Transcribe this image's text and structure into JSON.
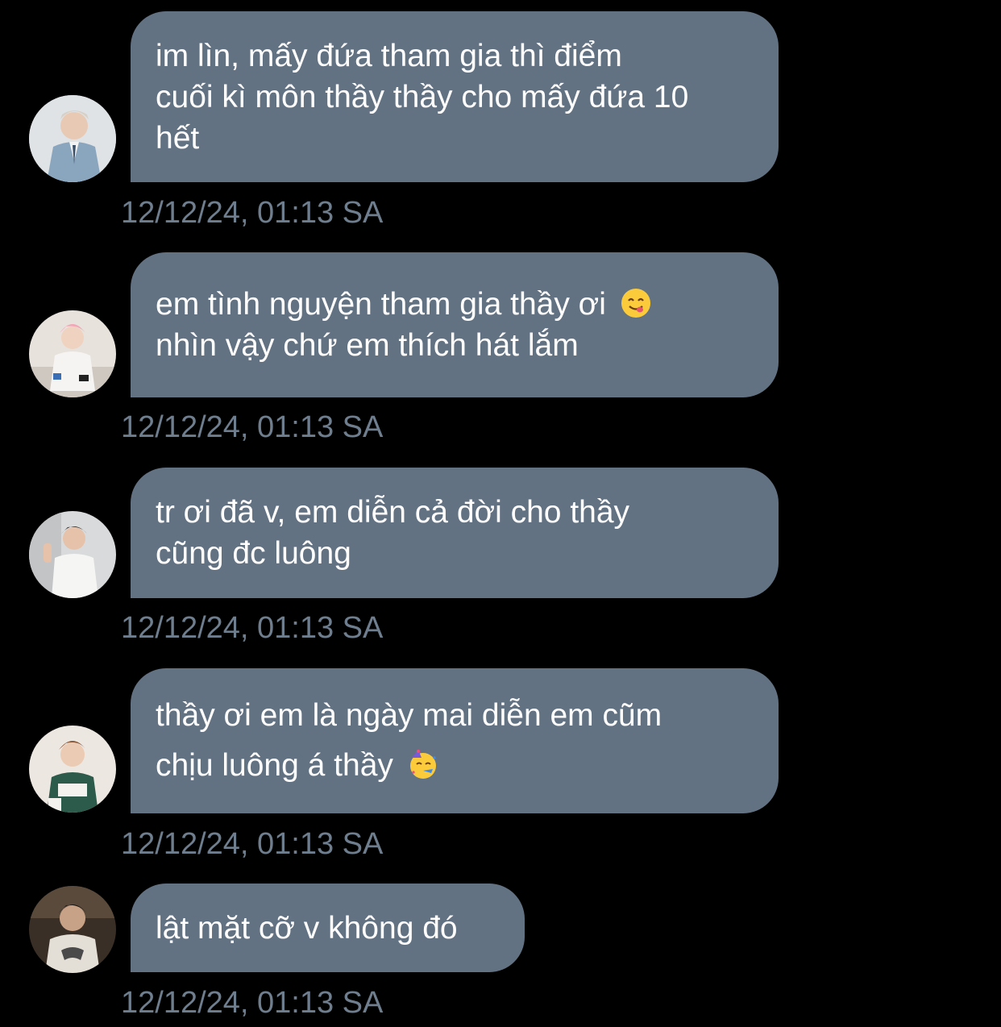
{
  "messages": [
    {
      "avatar": "avatar-man-blue-suit",
      "lines": [
        "im lìn, mấy đứa tham gia thì điểm",
        "cuối kì môn thầy thầy cho mấy đứa 10",
        "hết"
      ],
      "emoji": "",
      "time": "12/12/24, 01:13 SA"
    },
    {
      "avatar": "avatar-pink-hair",
      "lines": [
        "em tình nguyện tham gia thầy ơi",
        "nhìn vậy chứ em thích hát lắm"
      ],
      "emoji": "yum-face-emoji",
      "time": "12/12/24, 01:13 SA"
    },
    {
      "avatar": "avatar-white-jacket",
      "lines": [
        "tr ơi đã v, em diễn cả đời cho thầy",
        "cũng đc luông"
      ],
      "emoji": "",
      "time": "12/12/24, 01:13 SA"
    },
    {
      "avatar": "avatar-green-hoodie",
      "lines": [
        "thầy ơi em là ngày mai diễn em cũm",
        "chịu luông á thầy"
      ],
      "emoji": "party-face-emoji",
      "time": "12/12/24, 01:13 SA"
    },
    {
      "avatar": "avatar-beige-hoodie",
      "lines": [
        "lật mặt cỡ v không đó"
      ],
      "emoji": "",
      "time": "12/12/24, 01:13 SA"
    }
  ],
  "colors": {
    "background": "#000000",
    "bubble": "#637283",
    "timestamp": "#6f7e8e"
  }
}
